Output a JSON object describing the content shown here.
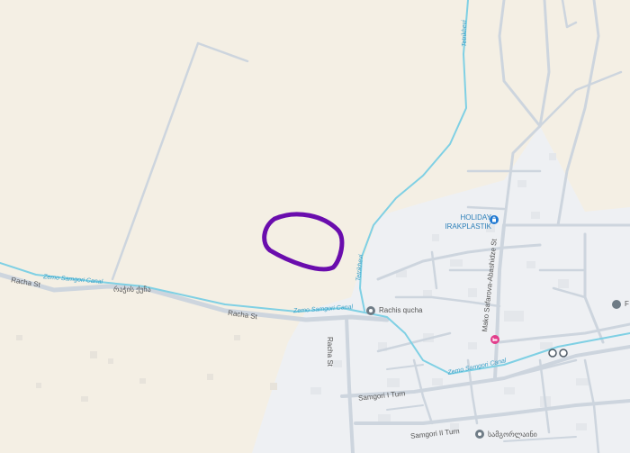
{
  "map": {
    "colors": {
      "land": "#f4efe4",
      "urban": "#eef0f3",
      "road": "#cdd5de",
      "water": "#7fd0e4",
      "marker": "#6a0dad",
      "poi_gray": "#6f7c86",
      "poi_blue": "#1f78d1",
      "poi_pink": "#e23d8b"
    },
    "street_labels": {
      "racha_st_west": "Racha St",
      "racha_st_geo": "რაჭის ქუჩა",
      "racha_st_mid": "Racha St",
      "racha_st_vertical": "Racha St",
      "mako_safarova_st": "Mako Safarova-Abashidze St",
      "samgori_1_turn": "Samgori I Turn",
      "samgori_2_turn": "Samgori II Turn"
    },
    "water_labels": {
      "zemo_samgori_canal_west": "Zemo Samgori Canal",
      "zemo_samgori_canal_mid": "Zemo Samgori Canal",
      "zemo_samgori_canal_east": "Zemo Samgori Canal",
      "tetrikhevi_north": "Tetrikhevi",
      "tetrikhevi_south": "Tetrikhevi"
    },
    "poi": {
      "holiday_irakplastik": "HOLIDAY IRAKPLASTIK",
      "rachis_qucha": "Rachis qucha",
      "samgori_geo": "სამგორლაინი",
      "edge_partial": "F"
    },
    "icons": {
      "holiday_icon": "shopping-bag-icon",
      "rachis_icon": "place-icon",
      "samgori_icon": "place-icon",
      "pink_icon": "hotel-icon",
      "transit_icon": "bus-stop-icon"
    }
  }
}
